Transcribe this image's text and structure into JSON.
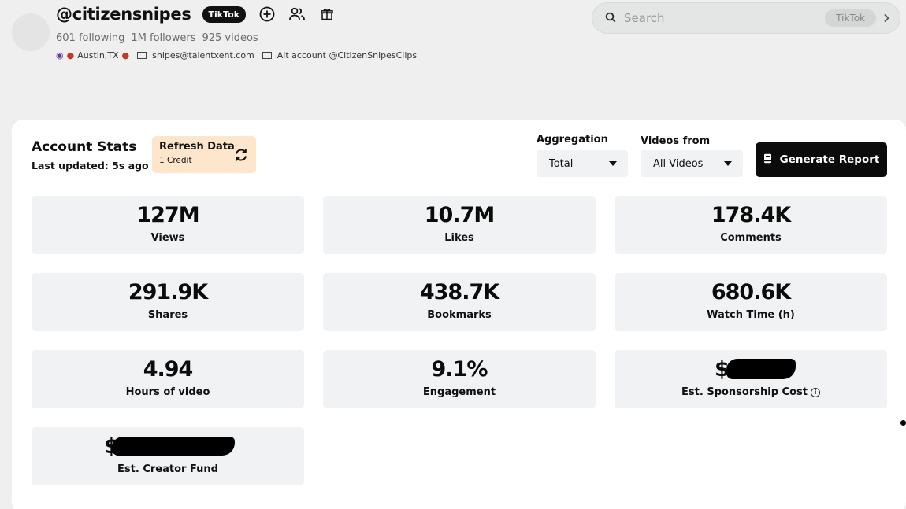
{
  "profile": {
    "handle": "@citizensnipes",
    "platform": "TikTok",
    "following": "601 following",
    "followers": "1M followers",
    "videos": "925 videos",
    "bio_location": "Austin,TX",
    "bio_email": "snipes@talentxent.com",
    "bio_alt": "Alt account @CitizenSnipesClips"
  },
  "search": {
    "placeholder": "Search",
    "platform_chip": "TikTok"
  },
  "stats_card": {
    "title": "Account Stats",
    "last_updated": "Last updated: 5s ago",
    "refresh_label": "Refresh Data",
    "refresh_cost": "1 Credit",
    "aggregation_label": "Aggregation",
    "aggregation_value": "Total",
    "videos_from_label": "Videos from",
    "videos_from_value": "All Videos",
    "generate_label": "Generate Report"
  },
  "stats": [
    {
      "value": "127M",
      "label": "Views"
    },
    {
      "value": "10.7M",
      "label": "Likes"
    },
    {
      "value": "178.4K",
      "label": "Comments"
    },
    {
      "value": "291.9K",
      "label": "Shares"
    },
    {
      "value": "438.7K",
      "label": "Bookmarks"
    },
    {
      "value": "680.6K",
      "label": "Watch Time (h)"
    },
    {
      "value": "4.94",
      "label": "Hours of video"
    },
    {
      "value": "9.1%",
      "label": "Engagement"
    },
    {
      "value": "$",
      "label": "Est. Sponsorship Cost"
    },
    {
      "value": "$",
      "label": "Est. Creator Fund"
    }
  ]
}
